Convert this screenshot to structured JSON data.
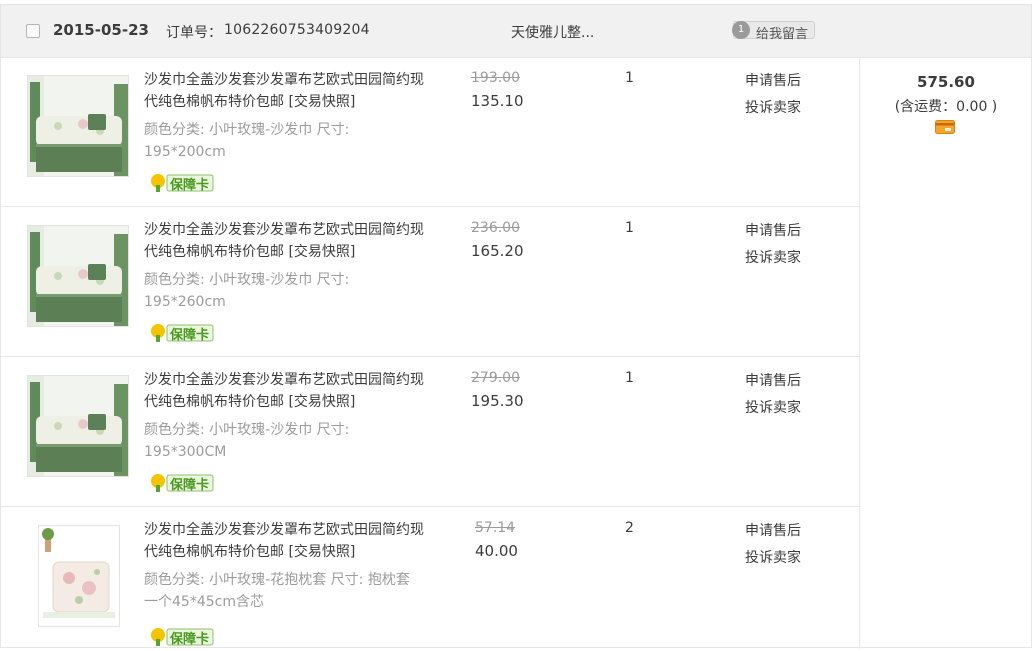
{
  "order": {
    "date": "2015-05-23",
    "order_no_label": "订单号：",
    "order_no": "1062260753409204",
    "shop_name": "天使雅儿整...",
    "message_button": "给我留言",
    "message_count": "1"
  },
  "items": [
    {
      "title": "沙发巾全盖沙发套沙发罩布艺欧式田园简约现代纯色棉帆布特价包邮 [交易快照]",
      "props": "颜色分类: 小叶玫瑰-沙发巾 尺寸: 195*200cm",
      "guarantee": "保障卡",
      "price_original": "193.00",
      "price": "135.10",
      "quantity": "1",
      "after_sale": "申请售后",
      "complain": "投诉卖家",
      "thumb_type": "sofa"
    },
    {
      "title": "沙发巾全盖沙发套沙发罩布艺欧式田园简约现代纯色棉帆布特价包邮 [交易快照]",
      "props": "颜色分类: 小叶玫瑰-沙发巾 尺寸: 195*260cm",
      "guarantee": "保障卡",
      "price_original": "236.00",
      "price": "165.20",
      "quantity": "1",
      "after_sale": "申请售后",
      "complain": "投诉卖家",
      "thumb_type": "sofa"
    },
    {
      "title": "沙发巾全盖沙发套沙发罩布艺欧式田园简约现代纯色棉帆布特价包邮 [交易快照]",
      "props": "颜色分类: 小叶玫瑰-沙发巾 尺寸: 195*300CM",
      "guarantee": "保障卡",
      "price_original": "279.00",
      "price": "195.30",
      "quantity": "1",
      "after_sale": "申请售后",
      "complain": "投诉卖家",
      "thumb_type": "sofa"
    },
    {
      "title": "沙发巾全盖沙发套沙发罩布艺欧式田园简约现代纯色棉帆布特价包邮 [交易快照]",
      "props": "颜色分类: 小叶玫瑰-花抱枕套 尺寸: 抱枕套一个45*45cm含芯",
      "guarantee": "保障卡",
      "price_original": "57.14",
      "price": "40.00",
      "quantity": "2",
      "after_sale": "申请售后",
      "complain": "投诉卖家",
      "thumb_type": "pillow"
    }
  ],
  "summary": {
    "total": "575.60",
    "shipping": "(含运费：0.00 )",
    "pay_icon": "card-icon"
  },
  "colors": {
    "header_bg": "#f1f1f1",
    "border": "#e6e6e6",
    "muted_text": "#9c9c9c",
    "guarantee_green": "#5aa62a",
    "guarantee_yellow": "#f5c400",
    "card_orange": "#f08a1c"
  }
}
